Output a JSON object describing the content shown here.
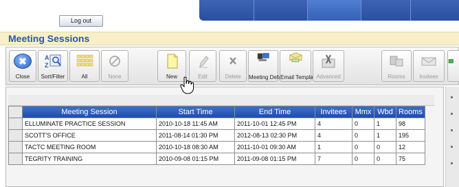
{
  "header": {
    "logout_label": "Log out",
    "nav_tabs": [
      "",
      "",
      "",
      "",
      ""
    ]
  },
  "section": {
    "title": "Meeting Sessions"
  },
  "toolbar": {
    "buttons": [
      {
        "label": "Close",
        "icon": "close-icon",
        "enabled": true
      },
      {
        "label": "Sort/Filter",
        "icon": "sort-filter-icon",
        "enabled": true
      },
      {
        "label": "All",
        "icon": "select-all-icon",
        "enabled": true
      },
      {
        "label": "None",
        "icon": "select-none-icon",
        "enabled": false
      },
      {
        "label": "New",
        "icon": "new-document-icon",
        "enabled": true
      },
      {
        "label": "Edit",
        "icon": "edit-pencil-icon",
        "enabled": false
      },
      {
        "label": "Delete",
        "icon": "delete-x-icon",
        "enabled": false
      },
      {
        "label": "Meeting Defaults",
        "icon": "meeting-defaults-icon",
        "enabled": true
      },
      {
        "label": "Email Templates",
        "icon": "email-templates-icon",
        "enabled": true
      },
      {
        "label": "Advanced",
        "icon": "advanced-tools-icon",
        "enabled": false
      },
      {
        "label": "Rooms",
        "icon": "rooms-icon",
        "enabled": false
      },
      {
        "label": "Invitees",
        "icon": "invitees-icon",
        "enabled": false
      }
    ]
  },
  "grid": {
    "columns": [
      "Meeting Session",
      "Start Time",
      "End Time",
      "Invitees",
      "Mmx",
      "Wbd",
      "Rooms"
    ],
    "rows": [
      [
        "ELLUMINATE PRACTICE SESSION",
        "2010-10-18 11:45 AM",
        "2011-10-01 12:45 PM",
        "4",
        "0",
        "1",
        "98"
      ],
      [
        "SCOTT'S OFFICE",
        "2011-08-14 01:30 PM",
        "2012-08-13 02:30 PM",
        "4",
        "0",
        "1",
        "195"
      ],
      [
        "TACTC MEETING ROOM",
        "2010-10-18 08:30 AM",
        "2011-10-01 09:30 AM",
        "1",
        "0",
        "0",
        "12"
      ],
      [
        "TEGRITY TRAINING",
        "2010-09-08 01:15 PM",
        "2011-09-08 01:15 PM",
        "7",
        "0",
        "0",
        "75"
      ]
    ]
  },
  "colors": {
    "nav_blue": "#2a4fa0",
    "header_blue": "#1d4bb0",
    "section_title": "#2957a8",
    "section_bg": "#f7efc8"
  }
}
